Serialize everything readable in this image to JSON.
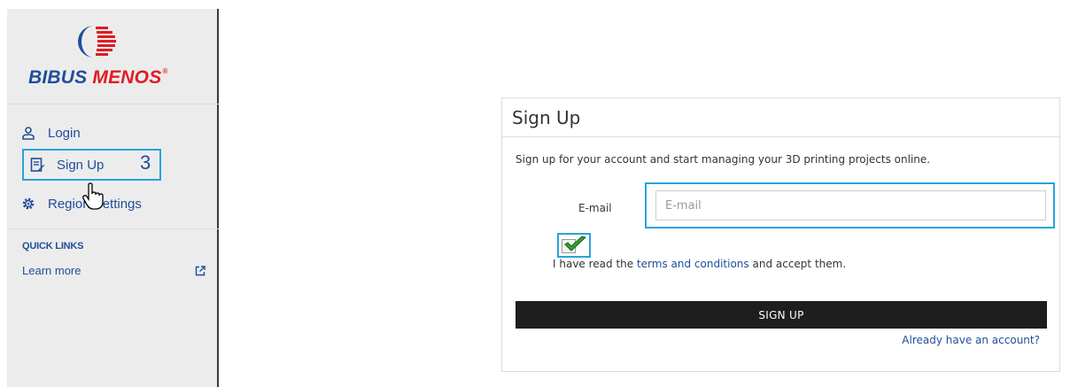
{
  "brand": {
    "part1": "BIBUS",
    "part2": "MENOS",
    "registered": "®",
    "colors": {
      "blue": "#1f4e9a",
      "red": "#e01b22"
    }
  },
  "sidebar": {
    "items": [
      {
        "label": "Login",
        "icon": "user-icon"
      },
      {
        "label": "Sign Up",
        "icon": "signup-form-icon",
        "step": "3"
      },
      {
        "label": "Region Settings",
        "icon": "gear-icon"
      }
    ],
    "quick_links": {
      "title": "QUICK LINKS",
      "items": [
        {
          "label": "Learn more",
          "icon": "external-link-icon"
        }
      ]
    }
  },
  "card": {
    "title": "Sign Up",
    "description": "Sign up for your account and start managing your 3D printing projects online.",
    "email": {
      "label": "E-mail",
      "placeholder": "E-mail",
      "value": ""
    },
    "terms": {
      "checked": true,
      "prefix": "I have read the ",
      "link": "terms and conditions",
      "suffix": " and accept them."
    },
    "submit_label": "SIGN UP",
    "already_link": "Already have an account?"
  },
  "colors": {
    "highlight": "#29a3dc",
    "sidebar_bg": "#ececec",
    "link": "#1f4e9a",
    "button_bg": "#1e1e1e",
    "check_green": "#2fa82f"
  }
}
